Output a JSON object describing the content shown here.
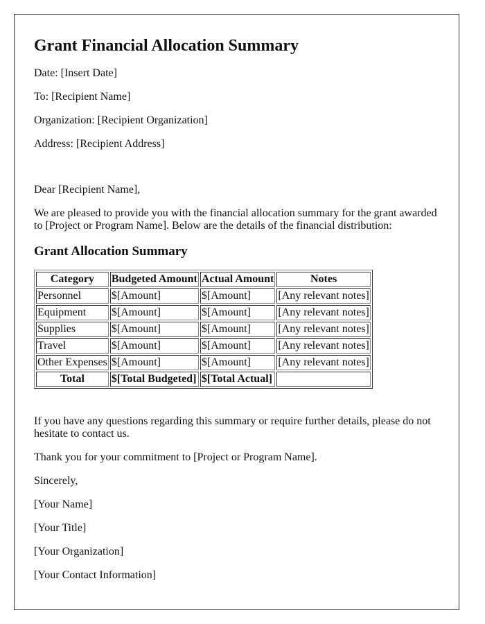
{
  "title": "Grant Financial Allocation Summary",
  "header_fields": {
    "date": "Date: [Insert Date]",
    "to": "To: [Recipient Name]",
    "organization": "Organization: [Recipient Organization]",
    "address": "Address: [Recipient Address]"
  },
  "salutation": "Dear [Recipient Name],",
  "intro": "We are pleased to provide you with the financial allocation summary for the grant awarded to [Project or Program Name]. Below are the details of the financial distribution:",
  "section_heading": "Grant Allocation Summary",
  "table": {
    "headers": [
      "Category",
      "Budgeted Amount",
      "Actual Amount",
      "Notes"
    ],
    "rows": [
      [
        "Personnel",
        "$[Amount]",
        "$[Amount]",
        "[Any relevant notes]"
      ],
      [
        "Equipment",
        "$[Amount]",
        "$[Amount]",
        "[Any relevant notes]"
      ],
      [
        "Supplies",
        "$[Amount]",
        "$[Amount]",
        "[Any relevant notes]"
      ],
      [
        "Travel",
        "$[Amount]",
        "$[Amount]",
        "[Any relevant notes]"
      ],
      [
        "Other Expenses",
        "$[Amount]",
        "$[Amount]",
        "[Any relevant notes]"
      ]
    ],
    "total": [
      "Total",
      "$[Total Budgeted]",
      "$[Total Actual]",
      ""
    ]
  },
  "closing_paragraphs": {
    "questions": "If you have any questions regarding this summary or require further details, please do not hesitate to contact us.",
    "thanks": "Thank you for your commitment to [Project or Program Name]."
  },
  "signature": {
    "valediction": "Sincerely,",
    "name": "[Your Name]",
    "title": "[Your Title]",
    "organization": "[Your Organization]",
    "contact": "[Your Contact Information]"
  }
}
